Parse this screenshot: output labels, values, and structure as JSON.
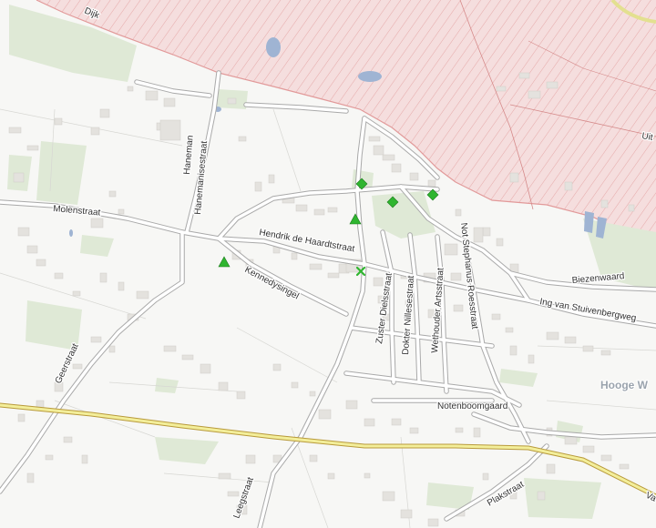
{
  "colors": {
    "background": "#f7f7f5",
    "dike_zone": "#f5dede",
    "dike_hatch": "#e29a9a",
    "meadow": "#dfe9d6",
    "water": "#9fb4d3",
    "road_outline": "#a9a9a9",
    "road_fill": "#ffffff",
    "highway_outline": "#b89a3b",
    "highway_fill": "#f3ee9a",
    "building": "#e4e2de",
    "marker": "#2fb52f"
  },
  "labels": {
    "dijk": "Dijk",
    "uit": "Uit",
    "haneman": "Haneman",
    "hanemanisestraat": "Hanemanisestraat",
    "molenstraat": "Molenstraat",
    "hendrik": "Hendrik de Haardtstraat",
    "kennedysingel": "Kennedysingel",
    "zuster": "Zuster Dielsstraat",
    "dokter": "Dokter Nillesestraat",
    "wethouder": "Wethouder Artsstraat",
    "notstephanus": "Not Stephanus Roesstraat",
    "biezenwaard": "Biezenwaard",
    "ingvan": "Ing van Stuivenbergweg",
    "hoogew": "Hooge W",
    "notenboomgaard": "Notenboomgaard",
    "geerstraat": "Geerstraat",
    "leegstraat": "Leegstraat",
    "plakstraat": "Plakstraat",
    "va": "Va"
  },
  "markers": [
    {
      "type": "diamond",
      "name": "diamond-marker-1"
    },
    {
      "type": "diamond",
      "name": "diamond-marker-2"
    },
    {
      "type": "diamond",
      "name": "diamond-marker-3"
    },
    {
      "type": "triangle",
      "name": "triangle-marker-1"
    },
    {
      "type": "triangle",
      "name": "triangle-marker-2"
    },
    {
      "type": "cross",
      "name": "cross-marker"
    }
  ]
}
